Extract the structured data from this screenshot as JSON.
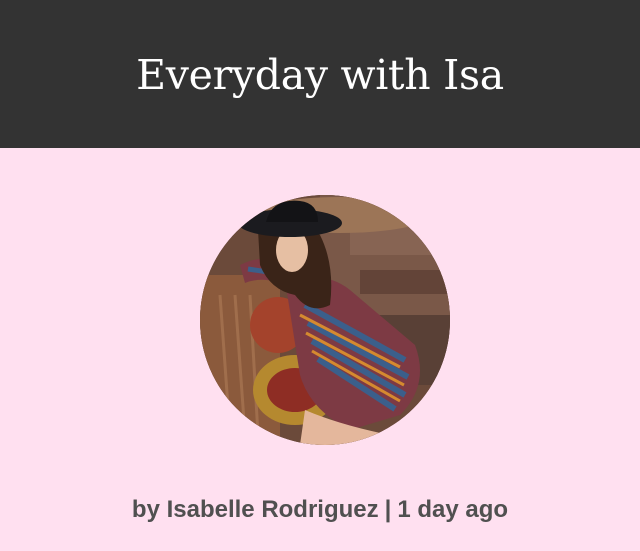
{
  "header": {
    "title": "Everyday with Isa",
    "background": "#333333"
  },
  "post": {
    "author": "Isabelle Rodriguez",
    "author_prefix": "by",
    "separator": "|",
    "timestamp": "1 day ago",
    "photo_icon": "author-photo"
  },
  "colors": {
    "page_background": "#ffe0f0",
    "byline_text": "#505050"
  }
}
